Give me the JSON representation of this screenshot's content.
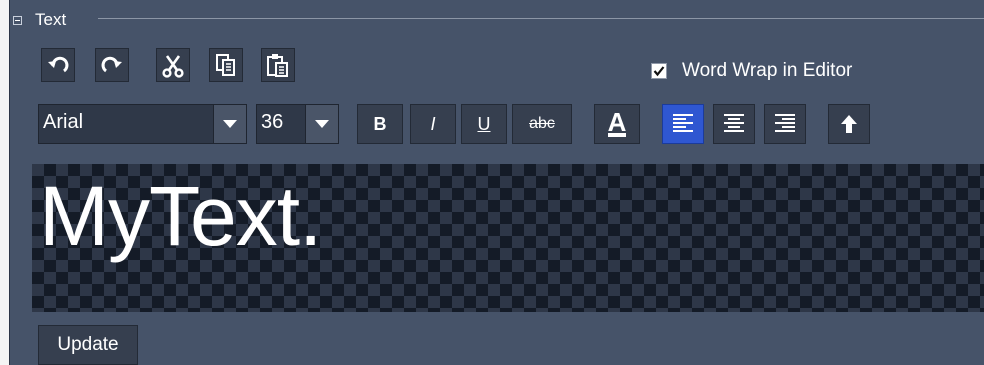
{
  "group": {
    "title": "Text",
    "collapse_icon": "minus-box-icon"
  },
  "toolbar": {
    "undo_icon": "undo-icon",
    "redo_icon": "redo-icon",
    "cut_icon": "scissors-icon",
    "copy_icon": "copy-icon",
    "paste_icon": "paste-icon"
  },
  "word_wrap": {
    "label": "Word Wrap in Editor",
    "checked": true
  },
  "format": {
    "font": "Arial",
    "size": "36",
    "bold_label": "B",
    "italic_label": "I",
    "underline_label": "U",
    "strike_label": "abc",
    "color_label": "A",
    "align": "left"
  },
  "preview": {
    "text": "MyText."
  },
  "footer": {
    "update_label": "Update"
  },
  "colors": {
    "panel": "#465369",
    "active_align": "#2f57d1",
    "checker_dark": "#141b27",
    "checker_light": "#2e3748"
  }
}
